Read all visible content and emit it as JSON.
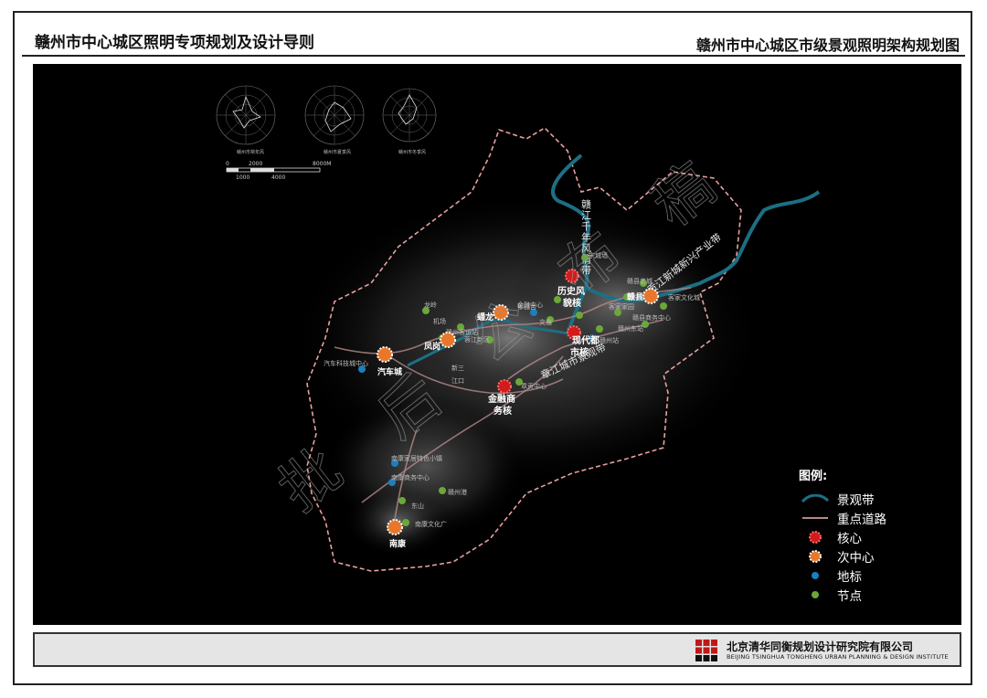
{
  "header": {
    "left_title": "赣州市中心城区照明专项规划及设计导则",
    "right_title": "赣州市中心城区市级景观照明架构规划图"
  },
  "compass": {
    "labels": [
      "赣州市常年风",
      "赣州市夏季风",
      "赣州市冬季风"
    ]
  },
  "scale_bar": {
    "top_ticks": [
      "0",
      "2000",
      "8000M"
    ],
    "bottom_ticks": [
      "1000",
      "4000"
    ]
  },
  "corridors": {
    "gan_river": "赣江千年风情带",
    "gong_river": "贡江新城新兴产业带",
    "zhang_river": "章江城市景观带"
  },
  "cores": [
    {
      "label_line1": "历史风",
      "label_line2": "貌核"
    },
    {
      "label_line1": "现代都",
      "label_line2": "市核"
    },
    {
      "label_line1": "金融商",
      "label_line2": "务核"
    }
  ],
  "sub_centers": [
    "赣县",
    "蟠龙",
    "凤岗",
    "汽车城",
    "南康"
  ],
  "landmarks": [
    "金融中心",
    "汽车科技城中心",
    "南康家居特色小镇",
    "南康商务中心",
    "章贡中心"
  ],
  "nodes": [
    "宋城墙",
    "郁孤台",
    "文庙",
    "赣县老城",
    "赣县商务中心",
    "客家文化城",
    "赣州站",
    "赣州东站",
    "客家家园",
    "机场",
    "赣州客运站",
    "新三",
    "江口",
    "赣州港",
    "东山",
    "南康文化广",
    "龙岭",
    "蓉江新区"
  ],
  "legend": {
    "title": "图例:",
    "items": [
      {
        "label": "景观带",
        "symbol": "landscape-belt"
      },
      {
        "label": "重点道路",
        "symbol": "key-road"
      },
      {
        "label": "核心",
        "symbol": "core"
      },
      {
        "label": "次中心",
        "symbol": "sub-center"
      },
      {
        "label": "地标",
        "symbol": "landmark"
      },
      {
        "label": "节点",
        "symbol": "node"
      }
    ]
  },
  "watermark": {
    "chars": [
      "批",
      "后",
      "公",
      "布",
      "稿"
    ]
  },
  "footer": {
    "institute_cn": "北京清华同衡规划设计研究院有限公司",
    "institute_en": "BEIJING TSINGHUA TONGHENG URBAN PLANNING & DESIGN INSTITUTE"
  },
  "colors": {
    "river": "#1d6f84",
    "boundary": "#e8a0a0",
    "road": "#b58a8a",
    "core": "#d31b1b",
    "sub_center": "#e8772b",
    "landmark": "#1c7fc0",
    "node": "#6aa83a"
  }
}
